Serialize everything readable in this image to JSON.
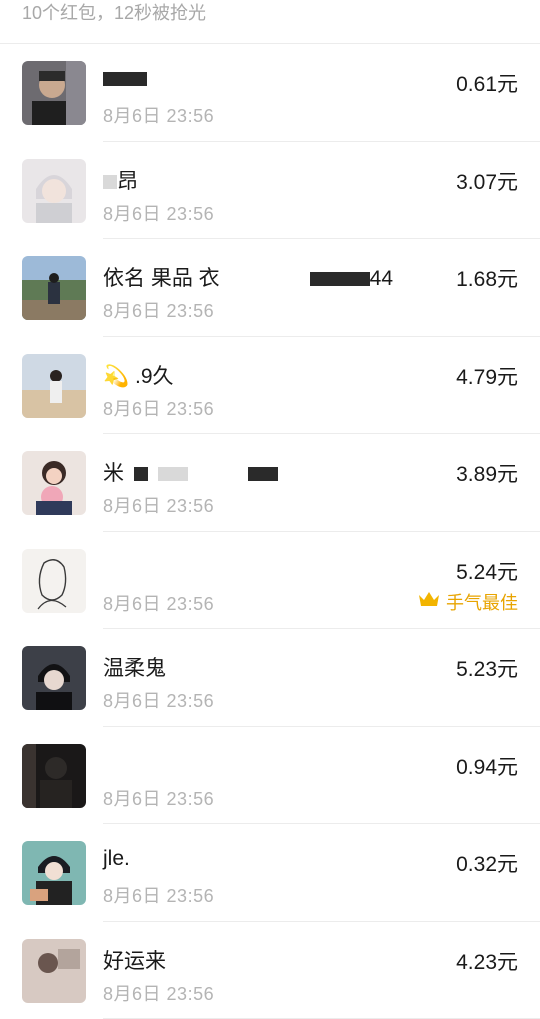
{
  "summary": "10个红包，12秒被抢光",
  "best_label": "手气最佳",
  "entries": [
    {
      "name": "",
      "date": "8月6日",
      "time": "23:56",
      "amount": "0.61元"
    },
    {
      "name": "昂",
      "date": "8月6日",
      "time": "23:56",
      "amount": "3.07元"
    },
    {
      "name": "依名 果品 衣",
      "suffix": "44",
      "date": "8月6日",
      "time": "23:56",
      "amount": "1.68元"
    },
    {
      "name": "💫 .9久",
      "date": "8月6日",
      "time": "23:56",
      "amount": "4.79元"
    },
    {
      "name": "米",
      "date": "8月6日",
      "time": "23:56",
      "amount": "3.89元"
    },
    {
      "name": "",
      "date": "8月6日",
      "time": "23:56",
      "amount": "5.24元",
      "best": true
    },
    {
      "name": "温柔鬼",
      "date": "8月6日",
      "time": "23:56",
      "amount": "5.23元"
    },
    {
      "name": "",
      "date": "8月6日",
      "time": "23:56",
      "amount": "0.94元"
    },
    {
      "name": "jle.",
      "date": "8月6日",
      "time": "23:56",
      "amount": "0.32元"
    },
    {
      "name": "好运来",
      "date": "8月6日",
      "time": "23:56",
      "amount": "4.23元"
    }
  ],
  "colors": {
    "best_accent": "#e8a400",
    "muted_text": "#b4b4b4",
    "divider": "#ececec"
  },
  "icons": {
    "best": "crown-icon"
  }
}
